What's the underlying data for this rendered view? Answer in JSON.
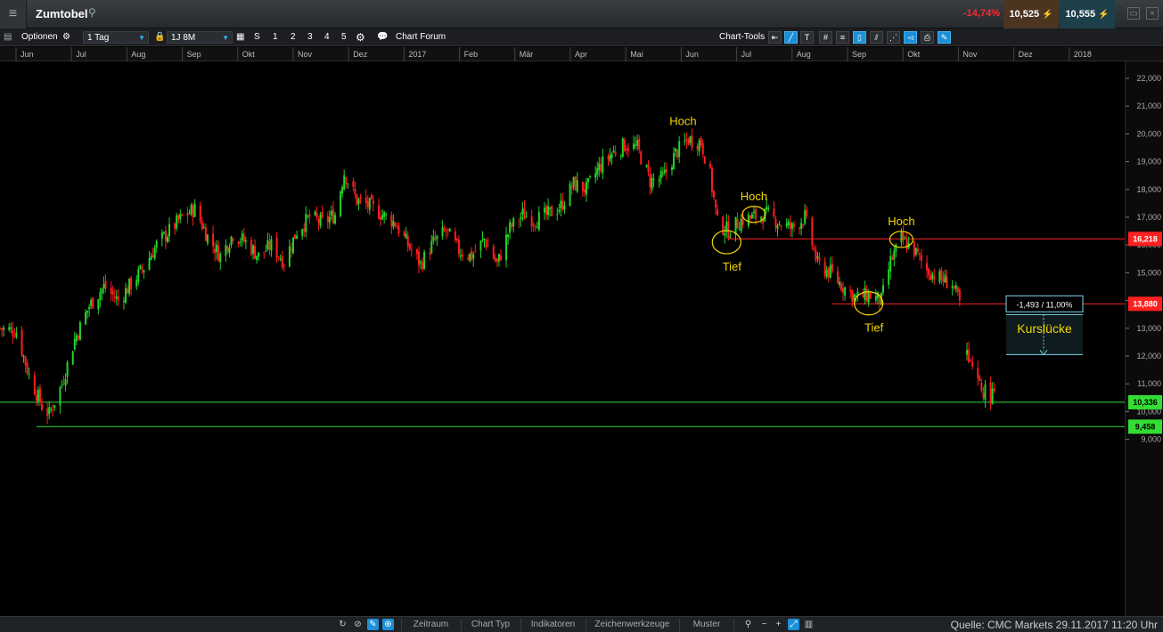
{
  "header": {
    "instrument": "Zumtobel",
    "change_pct": "-14,74%",
    "sell_price": "10,525",
    "buy_price": "10,555",
    "icons": [
      "menu-icon",
      "search-icon",
      "sell-arrow-icon",
      "buy-arrow-icon",
      "minimize-icon",
      "close-icon"
    ]
  },
  "toolbar": {
    "options_label": "Optionen",
    "interval": "1 Tag",
    "range": "1J 8M",
    "shortcuts": [
      "S",
      "1",
      "2",
      "3",
      "4",
      "5"
    ],
    "forum_label": "Chart Forum",
    "chart_tools_label": "Chart-Tools"
  },
  "time_axis": {
    "labels": [
      "Jun",
      "Jul",
      "Aug",
      "Sep",
      "Okt",
      "Nov",
      "Dez",
      "2017",
      "Feb",
      "Mär",
      "Apr",
      "Mai",
      "Jun",
      "Jul",
      "Aug",
      "Sep",
      "Okt",
      "Nov",
      "Dez",
      "2018"
    ]
  },
  "bottom": {
    "tabs": [
      "Zeitraum",
      "Chart Typ",
      "Indikatoren",
      "Zeichenwerkzeuge",
      "Muster"
    ],
    "source_note": "Quelle: CMC Markets 29.11.2017 11:20 Uhr"
  },
  "colors": {
    "up": "#22d32a",
    "down": "#ff1e1e",
    "annotation": "#f5d800",
    "resistance_line": "#ff2020",
    "support_line": "#33dd33",
    "accent": "#2fb7e6"
  },
  "chart_data": {
    "type": "candlestick",
    "instrument": "Zumtobel",
    "interval": "1 Tag",
    "y_ticks": [
      9000,
      10000,
      11000,
      12000,
      13000,
      14000,
      15000,
      16000,
      17000,
      18000,
      19000,
      20000,
      21000,
      22000
    ],
    "y_tick_labels": [
      "9,000",
      "10,000",
      "11,000",
      "12,000",
      "13,000",
      "14,000",
      "15,000",
      "16,000",
      "17,000",
      "18,000",
      "19,000",
      "20,000",
      "21,000",
      "22,000"
    ],
    "ylim": [
      8700,
      22300
    ],
    "x_range_months": [
      "2016-06",
      "2018-01"
    ],
    "approx_closes": [
      [
        "2016-06-01",
        13.0
      ],
      [
        "2016-06-10",
        12.9
      ],
      [
        "2016-06-17",
        11.3
      ],
      [
        "2016-06-24",
        10.2
      ],
      [
        "2016-06-28",
        9.9
      ],
      [
        "2016-07-05",
        11.0
      ],
      [
        "2016-07-12",
        12.6
      ],
      [
        "2016-07-20",
        13.8
      ],
      [
        "2016-07-28",
        14.5
      ],
      [
        "2016-08-05",
        14.0
      ],
      [
        "2016-08-12",
        14.6
      ],
      [
        "2016-08-19",
        15.2
      ],
      [
        "2016-08-26",
        16.0
      ],
      [
        "2016-09-02",
        16.5
      ],
      [
        "2016-09-09",
        17.0
      ],
      [
        "2016-09-16",
        17.3
      ],
      [
        "2016-09-23",
        16.3
      ],
      [
        "2016-09-30",
        15.6
      ],
      [
        "2016-10-07",
        16.4
      ],
      [
        "2016-10-14",
        16.1
      ],
      [
        "2016-10-21",
        15.6
      ],
      [
        "2016-10-28",
        16.0
      ],
      [
        "2016-11-04",
        15.4
      ],
      [
        "2016-11-11",
        16.5
      ],
      [
        "2016-11-18",
        17.0
      ],
      [
        "2016-11-25",
        16.8
      ],
      [
        "2016-12-02",
        17.1
      ],
      [
        "2016-12-07",
        18.6
      ],
      [
        "2016-12-14",
        17.6
      ],
      [
        "2016-12-21",
        17.4
      ],
      [
        "2017-01-04",
        16.8
      ],
      [
        "2017-01-11",
        16.0
      ],
      [
        "2017-01-18",
        15.3
      ],
      [
        "2017-01-25",
        16.1
      ],
      [
        "2017-02-01",
        16.5
      ],
      [
        "2017-02-08",
        15.8
      ],
      [
        "2017-02-15",
        15.6
      ],
      [
        "2017-02-22",
        16.2
      ],
      [
        "2017-03-01",
        15.3
      ],
      [
        "2017-03-08",
        16.6
      ],
      [
        "2017-03-15",
        17.1
      ],
      [
        "2017-03-22",
        16.9
      ],
      [
        "2017-03-29",
        17.1
      ],
      [
        "2017-04-05",
        17.4
      ],
      [
        "2017-04-12",
        18.2
      ],
      [
        "2017-04-19",
        18.0
      ],
      [
        "2017-04-26",
        18.8
      ],
      [
        "2017-05-03",
        19.3
      ],
      [
        "2017-05-10",
        19.6
      ],
      [
        "2017-05-17",
        19.5
      ],
      [
        "2017-05-24",
        18.3
      ],
      [
        "2017-05-31",
        18.4
      ],
      [
        "2017-06-07",
        19.3
      ],
      [
        "2017-06-14",
        19.8
      ],
      [
        "2017-06-21",
        19.7
      ],
      [
        "2017-06-26",
        18.5
      ],
      [
        "2017-06-30",
        16.8
      ],
      [
        "2017-07-06",
        16.5
      ],
      [
        "2017-07-13",
        16.9
      ],
      [
        "2017-07-20",
        17.0
      ],
      [
        "2017-07-27",
        17.1
      ],
      [
        "2017-08-03",
        16.8
      ],
      [
        "2017-08-10",
        16.6
      ],
      [
        "2017-08-17",
        17.0
      ],
      [
        "2017-08-24",
        15.3
      ],
      [
        "2017-08-31",
        15.0
      ],
      [
        "2017-09-07",
        14.5
      ],
      [
        "2017-09-14",
        14.1
      ],
      [
        "2017-09-21",
        14.2
      ],
      [
        "2017-09-28",
        14.0
      ],
      [
        "2017-10-03",
        15.4
      ],
      [
        "2017-10-09",
        16.2
      ],
      [
        "2017-10-16",
        15.8
      ],
      [
        "2017-10-23",
        15.1
      ],
      [
        "2017-10-30",
        14.8
      ],
      [
        "2017-11-06",
        14.6
      ],
      [
        "2017-11-10",
        13.9
      ],
      [
        "2017-11-14",
        12.0
      ],
      [
        "2017-11-17",
        11.4
      ],
      [
        "2017-11-22",
        10.8
      ],
      [
        "2017-11-29",
        10.5
      ]
    ],
    "horizontal_lines": [
      {
        "label": "16,218",
        "value": 16218,
        "color": "#ff2020"
      },
      {
        "label": "13,880",
        "value": 13880,
        "color": "#ff2020"
      },
      {
        "label": "10,336",
        "value": 10336,
        "color": "#33dd33"
      },
      {
        "label": "9,458",
        "value": 9458,
        "color": "#33dd33"
      }
    ],
    "annotations": [
      {
        "text": "Hoch",
        "date": "2017-06-14",
        "value": 20000
      },
      {
        "text": "Tief",
        "date": "2017-07-05",
        "value": 16100
      },
      {
        "text": "Hoch",
        "date": "2017-07-20",
        "value": 17100
      },
      {
        "text": "Tief",
        "date": "2017-09-21",
        "value": 13900
      },
      {
        "text": "Hoch",
        "date": "2017-10-09",
        "value": 16200
      }
    ],
    "gap_measure": {
      "text": "-1,493 / 11,00%",
      "from": 13880,
      "to": 12052
    },
    "gap_label": "Kurslücke"
  }
}
